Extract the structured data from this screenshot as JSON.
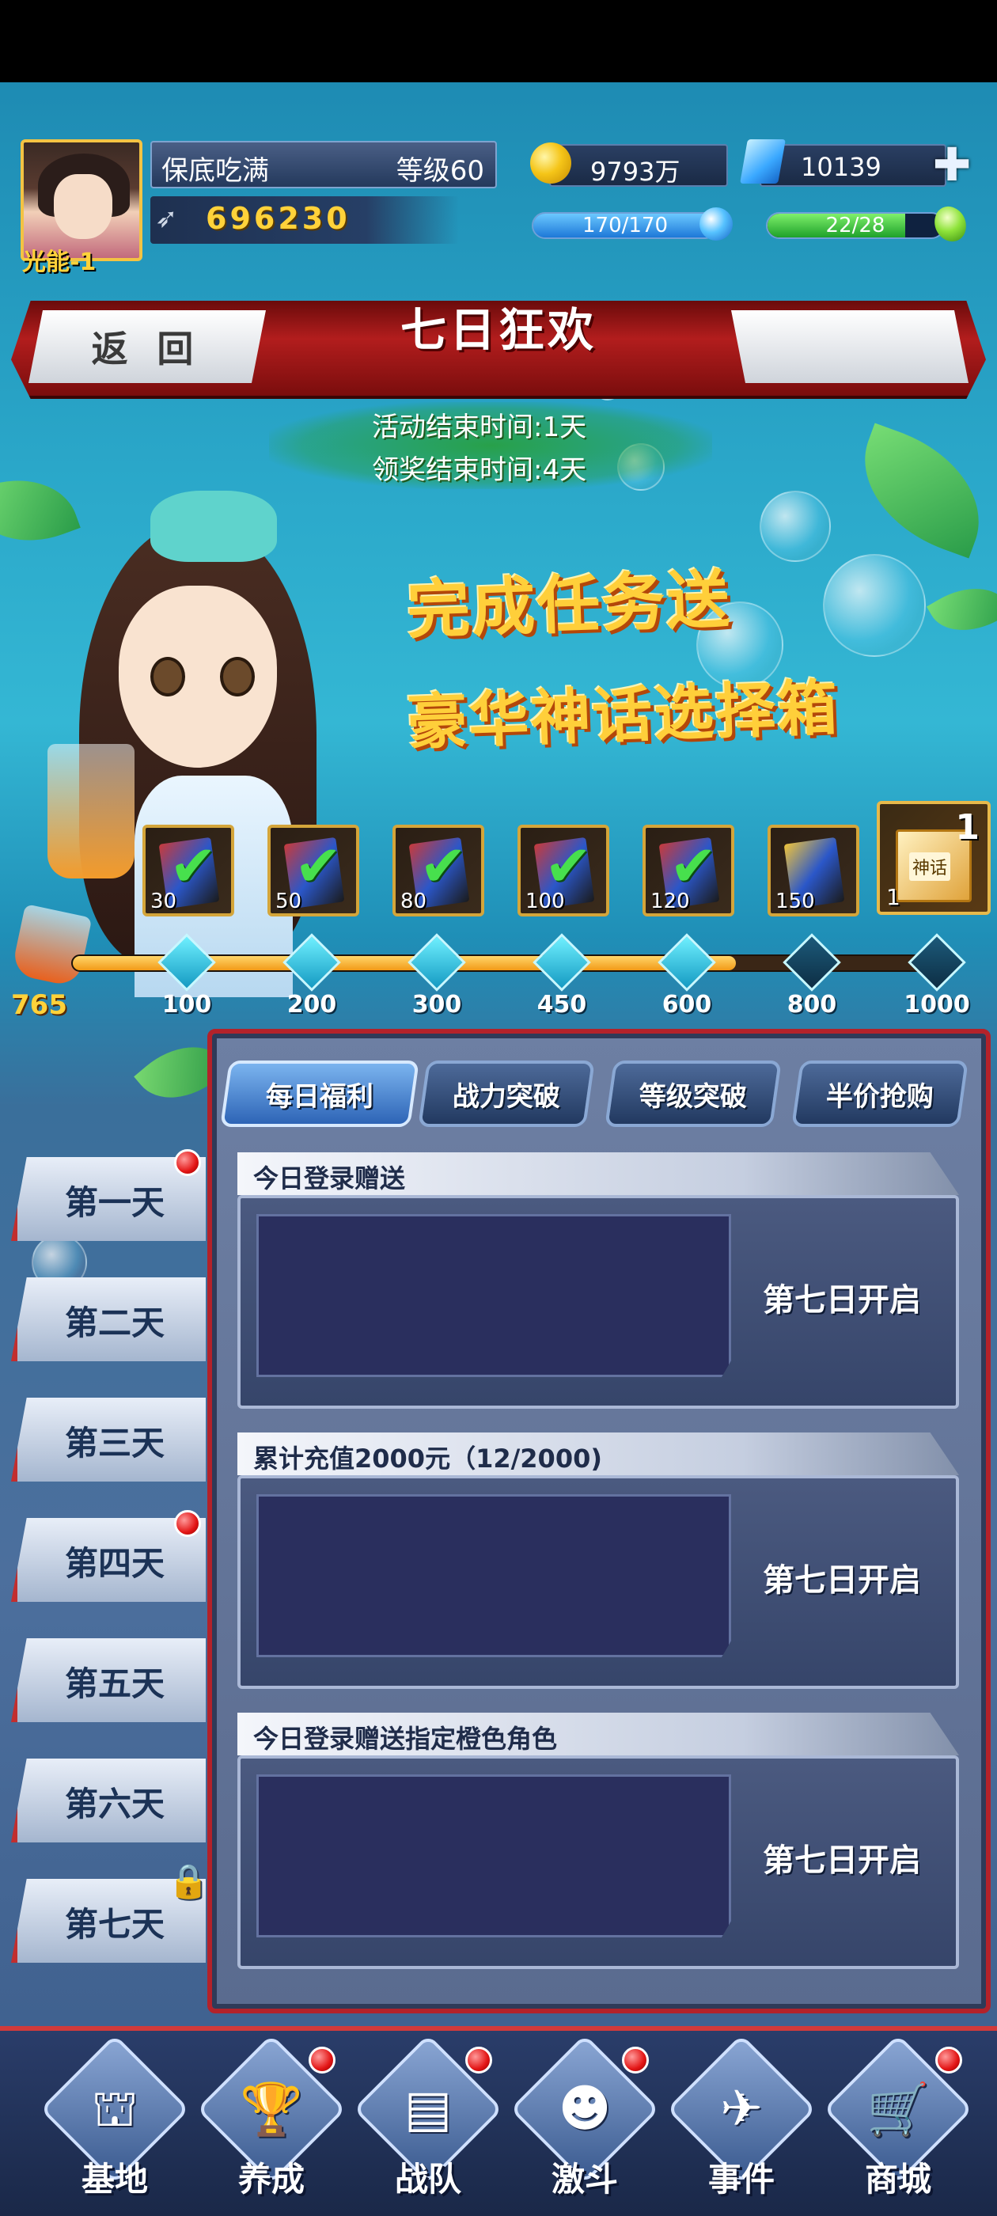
{
  "player": {
    "name": "保底吃满",
    "level": "等级60",
    "energy_label": "光能",
    "energy_value": "1",
    "power": "696230"
  },
  "resources": {
    "gold": "9793万",
    "gems": "10139",
    "stamina": "170/170",
    "stamina_fraction": 1.0,
    "vigor": "22/28",
    "vigor_fraction": 0.7857
  },
  "header": {
    "back_label": "返 回",
    "title": "七日狂欢"
  },
  "event": {
    "end_time": "活动结束时间:1天",
    "claim_time": "领奖结束时间:4天",
    "promo_line1": "完成任务送",
    "promo_line2": "豪华神话选择箱"
  },
  "rewards": [
    {
      "qty": "30",
      "claimed": true
    },
    {
      "qty": "50",
      "claimed": true
    },
    {
      "qty": "80",
      "claimed": true
    },
    {
      "qty": "100",
      "claimed": true
    },
    {
      "qty": "120",
      "claimed": true
    },
    {
      "qty": "150",
      "claimed": false
    },
    {
      "qty": "1",
      "count": "1",
      "box_label": "神话",
      "claimed": false
    }
  ],
  "progress": {
    "current": "765",
    "milestones": [
      "100",
      "200",
      "300",
      "450",
      "600",
      "800",
      "1000"
    ],
    "current_value": 765,
    "max_value": 1000
  },
  "tabs": [
    "每日福利",
    "战力突破",
    "等级突破",
    "半价抢购"
  ],
  "active_tab": 0,
  "days": [
    "第一天",
    "第二天",
    "第三天",
    "第四天",
    "第五天",
    "第六天",
    "第七天"
  ],
  "tasks": [
    {
      "title": "今日登录赠送",
      "status": "第七日开启"
    },
    {
      "title": "累计充值2000元（12/2000)",
      "status": "第七日开启"
    },
    {
      "title": "今日登录赠送指定橙色角色",
      "status": "第七日开启"
    }
  ],
  "nav": [
    {
      "label": "基地",
      "icon": "base-icon"
    },
    {
      "label": "养成",
      "icon": "trophy-icon"
    },
    {
      "label": "战队",
      "icon": "cards-icon"
    },
    {
      "label": "激斗",
      "icon": "fighter-icon"
    },
    {
      "label": "事件",
      "icon": "jet-icon"
    },
    {
      "label": "商城",
      "icon": "cart-icon"
    }
  ],
  "colors": {
    "accent_red": "#b3222a",
    "gold_text": "#ffd23a",
    "check_green": "#47e04d"
  }
}
